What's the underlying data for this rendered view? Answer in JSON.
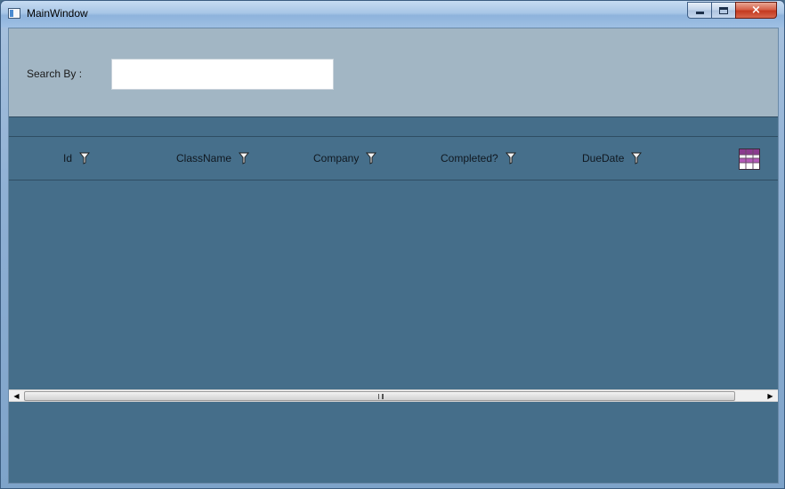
{
  "window": {
    "title": "MainWindow",
    "minimize_icon": "minimize-icon",
    "maximize_icon": "maximize-icon",
    "close_label": "×"
  },
  "search": {
    "label": "Search By :",
    "value": "",
    "placeholder": ""
  },
  "grid": {
    "columns": [
      {
        "label": "Id",
        "icon": "filter-icon"
      },
      {
        "label": "ClassName",
        "icon": "filter-icon"
      },
      {
        "label": "Company",
        "icon": "filter-icon"
      },
      {
        "label": "Completed?",
        "icon": "filter-icon"
      },
      {
        "label": "DueDate",
        "icon": "filter-icon"
      }
    ],
    "column_chooser_icon": "column-chooser-icon",
    "rows": []
  },
  "colors": {
    "search_panel": "#a2b6c4",
    "grid_background": "#456e8a",
    "chooser_accent": "#8b3a8f"
  }
}
